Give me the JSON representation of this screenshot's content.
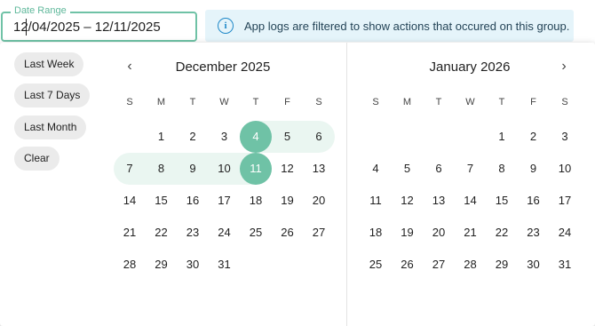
{
  "date_field": {
    "label": "Date Range",
    "value": "12/04/2025 – 12/11/2025"
  },
  "info_banner": {
    "icon": "info-icon",
    "text": "App logs are filtered to show actions that occured on this group."
  },
  "shortcuts": [
    "Last Week",
    "Last 7 Days",
    "Last Month",
    "Clear"
  ],
  "weekdays": [
    "S",
    "M",
    "T",
    "W",
    "T",
    "F",
    "S"
  ],
  "calendars": [
    {
      "title": "December 2025",
      "nav": "chevron-left-icon",
      "first_weekday": 1,
      "days": 31,
      "selected": [
        4,
        11
      ],
      "range": [
        4,
        11
      ]
    },
    {
      "title": "January 2026",
      "nav": "chevron-right-icon",
      "first_weekday": 4,
      "days": 31,
      "selected": [],
      "range": []
    }
  ],
  "colors": {
    "accent": "#6fc2a6",
    "range_fill": "#eaf6f1",
    "banner_bg": "#e5f4fa",
    "info_icon": "#1e88c8"
  }
}
